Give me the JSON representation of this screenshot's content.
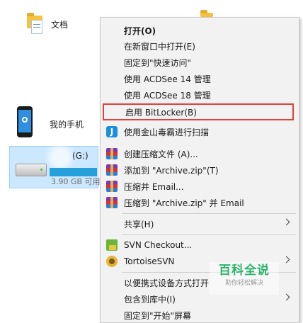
{
  "explorer": {
    "documents_label": "文档",
    "phone_label": "我的手机",
    "drive": {
      "label": "(G:)",
      "free_text": "3.90 GB 可用",
      "used_fraction": 0.98
    }
  },
  "context_menu": {
    "items": [
      {
        "label": "打开(O)",
        "bold": true
      },
      {
        "label": "在新窗口中打开(E)"
      },
      {
        "label": "固定到\"快速访问\""
      },
      {
        "label": "使用 ACDSee 14 管理"
      },
      {
        "label": "使用 ACDSee 18 管理"
      },
      {
        "label": "启用 BitLocker(B)",
        "highlighted": true
      },
      {
        "label": "使用金山毒霸进行扫描",
        "icon": "kingsoft-icon"
      },
      {
        "label": "创建压缩文件 (A)...",
        "icon": "winrar-icon"
      },
      {
        "label": "添加到 \"Archive.zip\"(T)",
        "icon": "winrar-icon"
      },
      {
        "label": "压缩并 Email...",
        "icon": "winrar-icon"
      },
      {
        "label": "压缩到 \"Archive.zip\" 并 Email",
        "icon": "winrar-icon"
      },
      {
        "label": "共享(H)",
        "submenu": true
      },
      {
        "label": "SVN Checkout...",
        "icon": "svn-checkout-icon"
      },
      {
        "label": "TortoiseSVN",
        "icon": "tortoisesvn-icon",
        "submenu": true
      },
      {
        "label": "以便携式设备方式打开"
      },
      {
        "label": "包含到库中(I)",
        "submenu": true
      },
      {
        "label": "固定到\"开始\"屏幕"
      }
    ]
  },
  "watermark": {
    "title": "百科全说",
    "subtitle": "助你轻松解决"
  },
  "colors": {
    "highlight_border": "#e0413a",
    "menu_background": "#f2f2f2",
    "selection": "#cce8ff",
    "watermark_green": "#2bb36a"
  }
}
